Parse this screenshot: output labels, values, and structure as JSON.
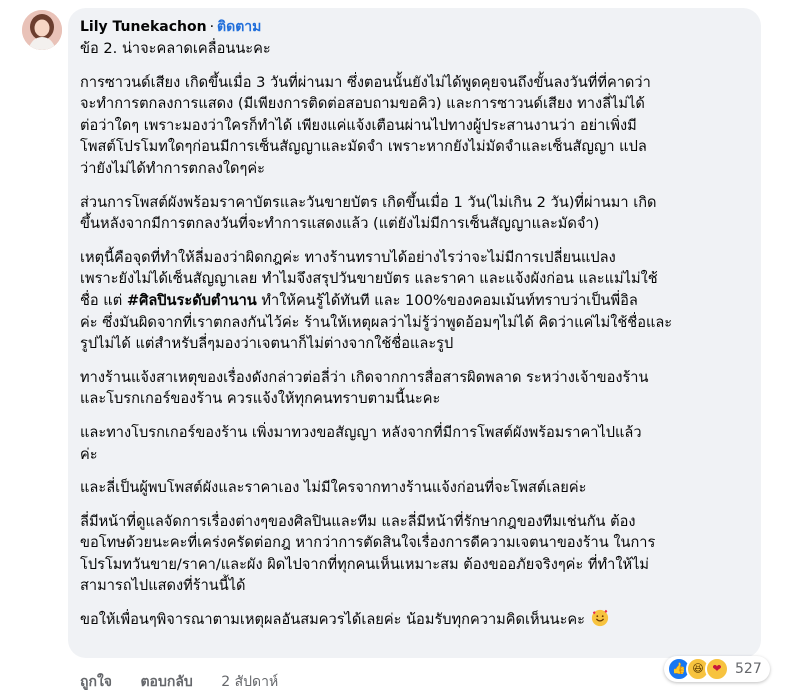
{
  "comment": {
    "author": "Lily Tunekachon",
    "separator": "·",
    "follow_label": "ติดตาม",
    "title_line": "ข้อ 2. น่าจะคลาดเคลื่อนนะคะ",
    "paragraphs": [
      {
        "lines": [
          "การซาวนด์เสียง เกิดขึ้นเมื่อ 3 วันที่ผ่านมา ซึ่งตอนนั้นยังไม่ได้พูดคุยจนถึงขั้นลงวันที่ที่คาดว่า",
          "จะทำการตกลงการแสดง (มีเพียงการติดต่อสอบถามขอคิว) และการซาวนด์เสียง ทางลี่ไม่ได้",
          "ต่อว่าใดๆ เพราะมองว่าใครก็ทำได้ เพียงแค่แจ้งเตือนผ่านไปทางผู้ประสานงานว่า อย่าเพิ่งมี",
          "โพสต์โปรโมทใดๆก่อนมีการเซ็นสัญญาและมัดจำ เพราะหากยังไม่มัดจำและเซ็นสัญญา แปล",
          "ว่ายังไม่ได้ทำการตกลงใดๆค่ะ"
        ]
      },
      {
        "lines": [
          "ส่วนการโพสต์ผังพร้อมราคาบัตรและวันขายบัตร เกิดขึ้นเมื่อ 1 วัน(ไม่เกิน 2 วัน)ที่ผ่านมา เกิด",
          "ขึ้นหลังจากมีการตกลงวันที่จะทำการแสดงแล้ว (แต่ยังไม่มีการเซ็นสัญญาและมัดจำ)"
        ]
      },
      {
        "lines": [
          "เหตุนี้คือจุดที่ทำให้ลี่มองว่าผิดกฎค่ะ ทางร้านทราบได้อย่างไรว่าจะไม่มีการเปลี่ยนแปลง",
          "เพราะยังไม่ได้เซ็นสัญญาเลย ทำไมจึงสรุปวันขายบัตร และราคา และแจ้งผังก่อน และแม่ไม่ใช้"
        ],
        "line3_pre": "ชื่อ แต่ ",
        "line3_bold": "#ศิลปินระดับตำนาน",
        "line3_post": " ทำให้คนรู้ได้ทันที และ 100%ของคอมเม้นท์ทราบว่าเป็นพี่อิล",
        "lines_after": [
          "ค่ะ ซึ่งมันผิดจากที่เราตกลงกันไว้ค่ะ ร้านให้เหตุผลว่าไม่รู้ว่าพูดอ้อมๆไม่ได้ คิดว่าแค่ไม่ใช้ชื่อและ",
          "รูปไม่ได้ แต่สำหรับลี่ๆมองว่าเจตนาก็ไม่ต่างจากใช้ชื่อและรูป"
        ]
      },
      {
        "lines": [
          "ทางร้านแจ้งสาเหตุของเรื่องดังกล่าวต่อลี่ว่า เกิดจากการสื่อสารผิดพลาด ระหว่างเจ้าของร้าน",
          "และโบรกเกอร์ของร้าน ควรแจ้งให้ทุกคนทราบตามนี้นะคะ"
        ]
      },
      {
        "lines": [
          "และทางโบรกเกอร์ของร้าน เพิ่งมาทวงขอสัญญา หลังจากที่มีการโพสต์ผังพร้อมราคาไปแล้ว",
          "ค่ะ"
        ]
      },
      {
        "lines": [
          "และลี่เป็นผู้พบโพสต์ผังและราคาเอง ไม่มีใครจากทางร้านแจ้งก่อนที่จะโพสต์เลยค่ะ"
        ]
      },
      {
        "lines": [
          "ลี่มีหน้าที่ดูแลจัดการเรื่องต่างๆของศิลปินและทีม และลี่มีหน้าที่รักษากฎของทีมเช่นกัน ต้อง",
          "ขอโทษด้วยนะคะที่เคร่งครัดต่อกฎ หากว่าการตัดสินใจเรื่องการดีความเจตนาของร้าน ในการ",
          "โปรโมทวันขาย/ราคา/และผัง ผิดไปจากที่ทุกคนเห็นเหมาะสม ต้องขออภัยจริงๆค่ะ ที่ทำให้ไม่",
          "สามารถไปแสดงที่ร้านนี้ได้"
        ]
      },
      {
        "lines": [
          "ขอให้เพื่อนๆพิจารณาตามเหตุผลอันสมควรได้เลยค่ะ น้อมรับทุกความคิดเห็นนะคะ"
        ]
      }
    ],
    "end_emoji": "smiling-face-with-hearts-icon"
  },
  "reactions": {
    "icons": [
      "like-icon",
      "haha-icon",
      "care-icon"
    ],
    "count": "527"
  },
  "actions": {
    "like": "ถูกใจ",
    "reply": "ตอบกลับ",
    "time": "2 สัปดาห์"
  },
  "colors": {
    "bubble_bg": "#f0f2f5",
    "follow": "#216fdb",
    "meta": "#65676b",
    "like": "#1877f2",
    "haha": "#f7c33f"
  }
}
